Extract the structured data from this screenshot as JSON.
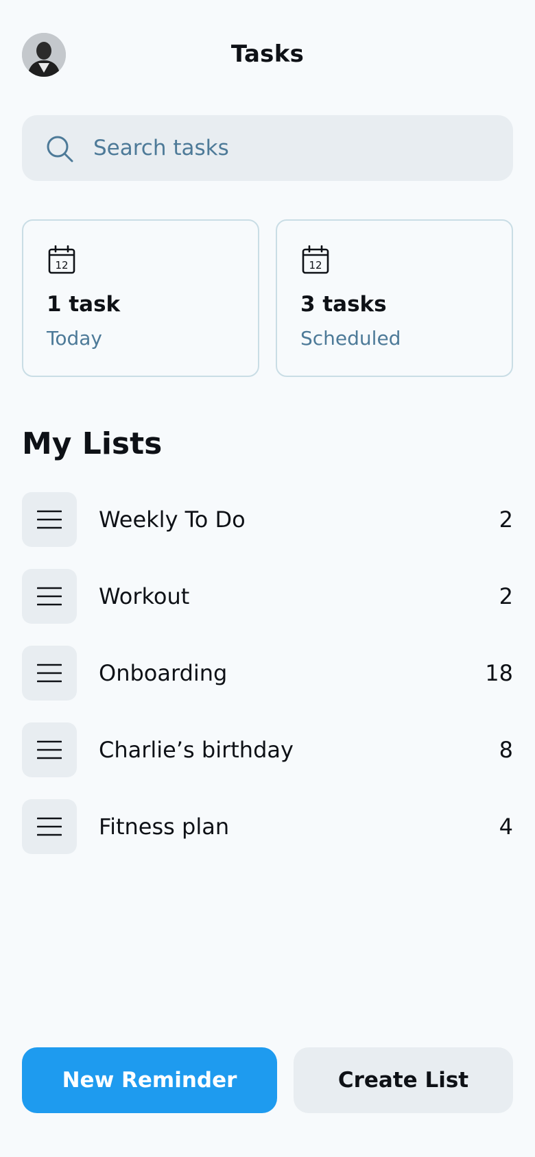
{
  "header": {
    "title": "Tasks",
    "avatar_icon": "user-avatar-photo"
  },
  "search": {
    "placeholder": "Search tasks",
    "value": "",
    "icon": "search-icon"
  },
  "summary_cards": [
    {
      "icon": "calendar-icon",
      "calendar_day": "12",
      "count_label": "1 task",
      "label": "Today"
    },
    {
      "icon": "calendar-icon",
      "calendar_day": "12",
      "count_label": "3 tasks",
      "label": "Scheduled"
    }
  ],
  "lists": {
    "title": "My Lists",
    "items": [
      {
        "icon": "list-icon",
        "name": "Weekly To Do",
        "count": "2"
      },
      {
        "icon": "list-icon",
        "name": "Workout",
        "count": "2"
      },
      {
        "icon": "list-icon",
        "name": "Onboarding",
        "count": "18"
      },
      {
        "icon": "list-icon",
        "name": "Charlie’s birthday",
        "count": "8"
      },
      {
        "icon": "list-icon",
        "name": "Fitness plan",
        "count": "4"
      }
    ]
  },
  "actions": {
    "new_reminder_label": "New Reminder",
    "create_list_label": "Create List"
  },
  "colors": {
    "accent": "#1e9bef",
    "muted_text": "#4d7a98",
    "surface": "#e8edf1",
    "background": "#f7fafc"
  }
}
